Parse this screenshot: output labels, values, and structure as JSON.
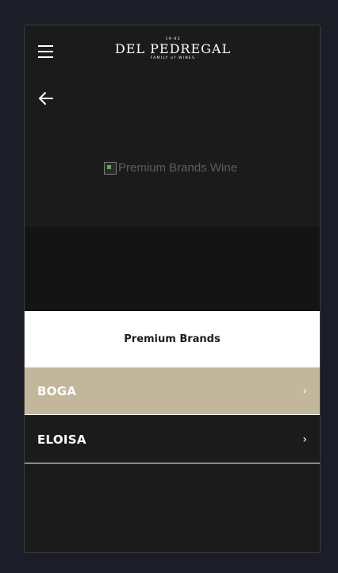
{
  "header": {
    "menu_icon": "hamburger-menu-icon",
    "logo": {
      "top": "19·85",
      "name": "DEL PEDREGAL",
      "tagline": "FAMILY of WINES"
    }
  },
  "navigation": {
    "back_icon": "arrow-left-icon"
  },
  "hero": {
    "image_alt": "Premium Brands Wine"
  },
  "section": {
    "title": "Premium Brands"
  },
  "brands": [
    {
      "label": "BOGA",
      "chevron": "›",
      "active": true
    },
    {
      "label": "ELOISA",
      "chevron": "›",
      "active": false
    }
  ],
  "colors": {
    "page_background": "#1b1e26",
    "panel_background": "#1b1b1b",
    "active_item": "#c2b79a",
    "section_background": "#ffffff",
    "text_light": "#ffffff",
    "text_dark": "#1b1e26"
  }
}
